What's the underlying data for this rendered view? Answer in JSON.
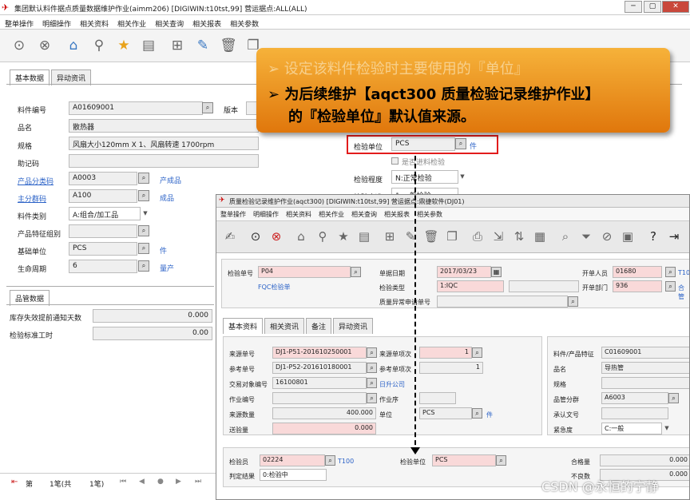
{
  "window": {
    "title": "集团默认料件据点质量数据维护作业(aimm206)    [DIGIWIN:t10tst,99]    营运据点:ALL(ALL)",
    "min": "─",
    "max": "▢",
    "close": "✕"
  },
  "menu": [
    "整单操作",
    "明细操作",
    "相关资料",
    "相关作业",
    "相关查询",
    "相关报表",
    "相关参数"
  ],
  "tabs": {
    "basic": "基本数据",
    "change": "异动资讯"
  },
  "fields": {
    "item_no": {
      "label": "料件编号",
      "value": "A01609001"
    },
    "version": {
      "label": "版本"
    },
    "name": {
      "label": "品名",
      "value": "散热器"
    },
    "spec": {
      "label": "规格",
      "value": "风扇大小120mm X 1、风扇转速 1700rpm"
    },
    "mnemonic": {
      "label": "助记码",
      "value": ""
    },
    "category": {
      "label": "产品分类码",
      "value": "A0003",
      "desc": "产成品"
    },
    "main_group": {
      "label": "主分群码",
      "value": "A100",
      "desc": "成品"
    },
    "item_type": {
      "label": "料件类别",
      "value": "A:组合/加工品"
    },
    "feature_group": {
      "label": "产品特征组别",
      "value": ""
    },
    "base_unit": {
      "label": "基础单位",
      "value": "PCS",
      "desc": "件"
    },
    "life_cycle": {
      "label": "生命周期",
      "value": "6",
      "desc": "量产"
    },
    "insp_unit": {
      "label": "检验单位",
      "value": "PCS",
      "desc": "件"
    },
    "is_incoming": {
      "label": "是否进料检验"
    },
    "insp_level": {
      "label": "检验程度",
      "value": "N:正常检验"
    },
    "insp_std": {
      "label": "检验水准",
      "value": "1:一般检验"
    }
  },
  "quality": {
    "tab": "品管数据",
    "rows": [
      {
        "label": "库存失效提前通知天数",
        "value": "0.000"
      },
      {
        "label": "检验标准工时",
        "value": "0.00"
      }
    ]
  },
  "pager": {
    "prefix": "第",
    "current": "1笔(共",
    "total": "1笔)"
  },
  "callout": {
    "line1": "➢ 设定该料件检验时主要使用的『单位』",
    "line2": "➢ 为后续维护【aqct300 质量检验记录维护作业】",
    "line3": "的『检验单位』默认值来源。"
  },
  "overlay": {
    "title": "质量检验记录维护作业(aqct300)    [DIGIWIN:t10tst,99]    营运据点:鼎捷软件(DJ01)",
    "menu": [
      "整单操作",
      "明细操作",
      "相关资料",
      "相关作业",
      "相关查询",
      "相关报表",
      "相关参数"
    ],
    "header": {
      "doc_no": {
        "label": "检验单号",
        "value": "P04",
        "desc": "FQC检验单"
      },
      "doc_date": {
        "label": "单据日期",
        "value": "2017/03/23"
      },
      "creator": {
        "label": "开单人员",
        "value": "01680",
        "desc": "T100"
      },
      "insp_type": {
        "label": "检验类型",
        "value": "1:IQC"
      },
      "dept": {
        "label": "开单部门",
        "value": "936",
        "desc": "合管"
      },
      "abnormal": {
        "label": "质量异常申请单号",
        "value": ""
      }
    },
    "tabs": [
      "基本资料",
      "相关资讯",
      "备注",
      "异动资讯"
    ],
    "body": {
      "src_no": {
        "label": "来源单号",
        "value": "DJ1-P51-201610250001"
      },
      "src_seq": {
        "label": "来源单项次",
        "value": "1"
      },
      "ref_no": {
        "label": "参考单号",
        "value": "DJ1-P52-201610180001"
      },
      "ref_seq": {
        "label": "参考单项次",
        "value": "1"
      },
      "party": {
        "label": "交易对象编号",
        "value": "16100801",
        "desc": "日升公司"
      },
      "op": {
        "label": "作业编号",
        "value": ""
      },
      "op_seq": {
        "label": "作业序",
        "value": ""
      },
      "src_qty": {
        "label": "来源数量",
        "value": "400.000"
      },
      "unit": {
        "label": "单位",
        "value": "PCS",
        "desc": "件"
      },
      "send_qty": {
        "label": "送验量",
        "value": "0.000"
      },
      "item": {
        "label": "料件/产品特征",
        "value": "C01609001"
      },
      "name": {
        "label": "品名",
        "value": "导热管"
      },
      "spec": {
        "label": "规格",
        "value": ""
      },
      "qgroup": {
        "label": "品管分群",
        "value": "A6003"
      },
      "approval": {
        "label": "承认文号",
        "value": ""
      },
      "urgency": {
        "label": "紧急度",
        "value": "C:一般"
      }
    },
    "footer": {
      "inspector": {
        "label": "检验员",
        "value": "02224",
        "desc": "T100"
      },
      "insp_unit": {
        "label": "检验单位",
        "value": "PCS"
      },
      "result": {
        "label": "判定结果",
        "value": "0:检验中"
      },
      "pass_qty": {
        "label": "合格量",
        "value": "0.000"
      },
      "bad_qty": {
        "label": "不良数",
        "value": "0.000"
      }
    }
  },
  "watermark": "CSDN @永恒的宁静"
}
